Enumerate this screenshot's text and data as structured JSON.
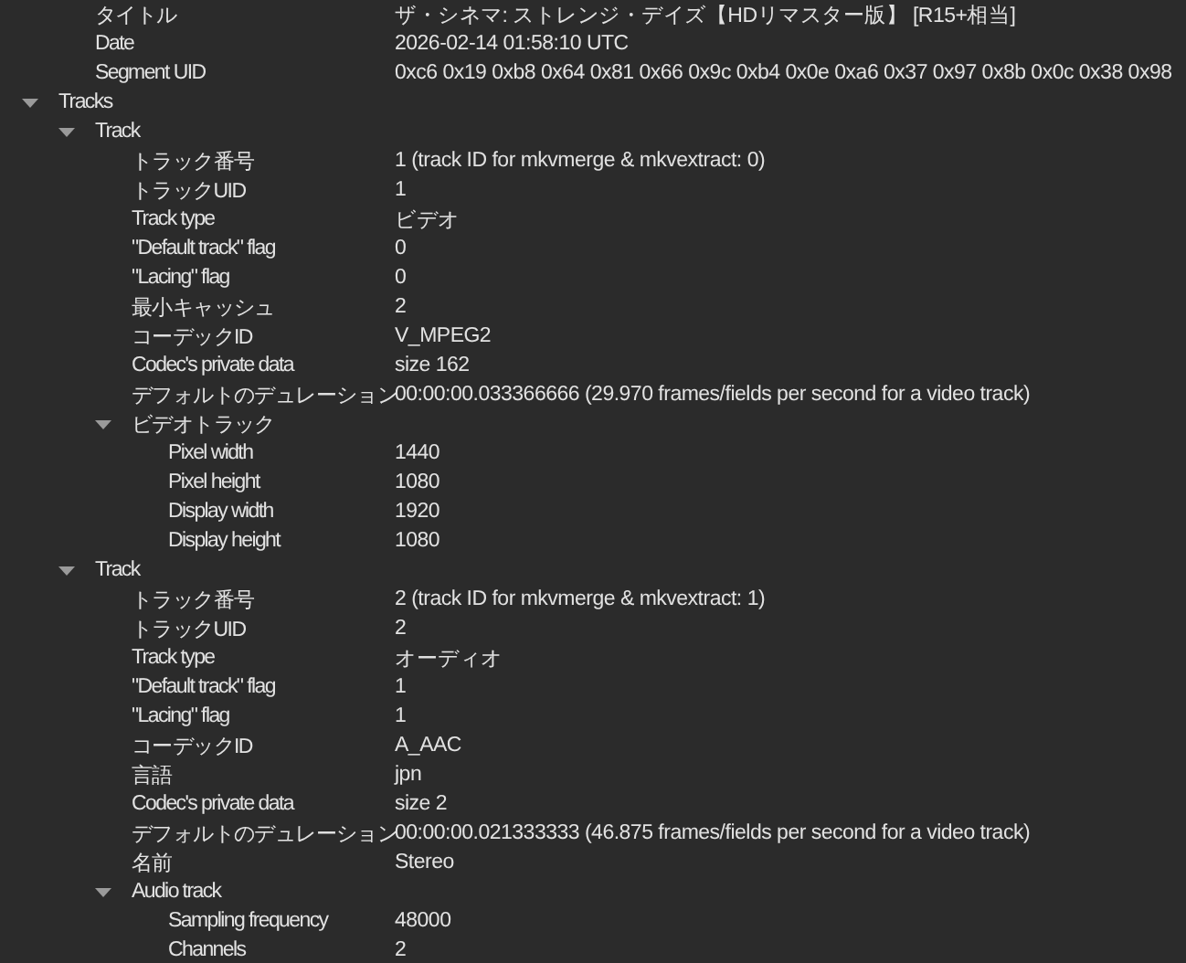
{
  "tree": {
    "continued_rows": [
      {
        "label": "タイトル",
        "value": "ザ・シネマ: ストレンジ・デイズ【HDリマスター版】 [R15+相当]"
      },
      {
        "label": "Date",
        "value": "2026-02-14 01:58:10 UTC"
      },
      {
        "label": "Segment UID",
        "value": "0xc6 0x19 0xb8 0x64 0x81 0x66 0x9c 0xb4 0x0e 0xa6 0x37 0x97 0x8b 0x0c 0x38 0x98"
      }
    ],
    "nodes": [
      {
        "label": "Tracks",
        "expanded": true,
        "children": [
          {
            "label": "Track",
            "expanded": true,
            "children": [
              {
                "label": "トラック番号",
                "value": "1 (track ID for mkvmerge & mkvextract: 0)"
              },
              {
                "label": "トラックUID",
                "value": "1"
              },
              {
                "label": "Track type",
                "value": "ビデオ"
              },
              {
                "label": "\"Default track\" flag",
                "value": "0"
              },
              {
                "label": "\"Lacing\" flag",
                "value": "0"
              },
              {
                "label": "最小キャッシュ",
                "value": "2"
              },
              {
                "label": "コーデックID",
                "value": "V_MPEG2"
              },
              {
                "label": "Codec's private data",
                "value": "size 162"
              },
              {
                "label": "デフォルトのデュレーション",
                "value": "00:00:00.033366666 (29.970 frames/fields per second for a video track)"
              },
              {
                "label": "ビデオトラック",
                "expanded": true,
                "children": [
                  {
                    "label": "Pixel width",
                    "value": "1440"
                  },
                  {
                    "label": "Pixel height",
                    "value": "1080"
                  },
                  {
                    "label": "Display width",
                    "value": "1920"
                  },
                  {
                    "label": "Display height",
                    "value": "1080"
                  }
                ]
              }
            ]
          },
          {
            "label": "Track",
            "expanded": true,
            "children": [
              {
                "label": "トラック番号",
                "value": "2 (track ID for mkvmerge & mkvextract: 1)"
              },
              {
                "label": "トラックUID",
                "value": "2"
              },
              {
                "label": "Track type",
                "value": "オーディオ"
              },
              {
                "label": "\"Default track\" flag",
                "value": "1"
              },
              {
                "label": "\"Lacing\" flag",
                "value": "1"
              },
              {
                "label": "コーデックID",
                "value": "A_AAC"
              },
              {
                "label": "言語",
                "value": "jpn"
              },
              {
                "label": "Codec's private data",
                "value": "size 2"
              },
              {
                "label": "デフォルトのデュレーション",
                "value": "00:00:00.021333333 (46.875 frames/fields per second for a video track)"
              },
              {
                "label": "名前",
                "value": "Stereo"
              },
              {
                "label": "Audio track",
                "expanded": true,
                "children": [
                  {
                    "label": "Sampling frequency",
                    "value": "48000"
                  },
                  {
                    "label": "Channels",
                    "value": "2"
                  }
                ]
              }
            ]
          }
        ]
      }
    ]
  }
}
